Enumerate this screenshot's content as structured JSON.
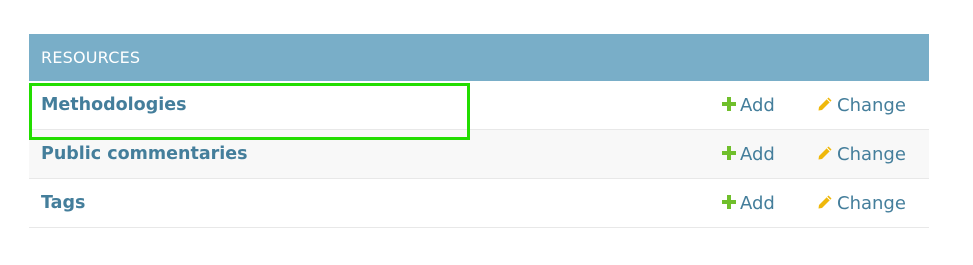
{
  "module": {
    "caption": "RESOURCES",
    "rows": [
      {
        "name": "Methodologies",
        "add_label": "Add",
        "change_label": "Change"
      },
      {
        "name": "Public commentaries",
        "add_label": "Add",
        "change_label": "Change"
      },
      {
        "name": "Tags",
        "add_label": "Add",
        "change_label": "Change"
      }
    ]
  },
  "icons": {
    "add": "plus-icon",
    "change": "pencil-icon"
  },
  "colors": {
    "caption_bg": "#79aec8",
    "link": "#447e9b",
    "add_icon": "#70bf2b",
    "change_icon": "#efb80b",
    "highlight": "#22dd00"
  }
}
